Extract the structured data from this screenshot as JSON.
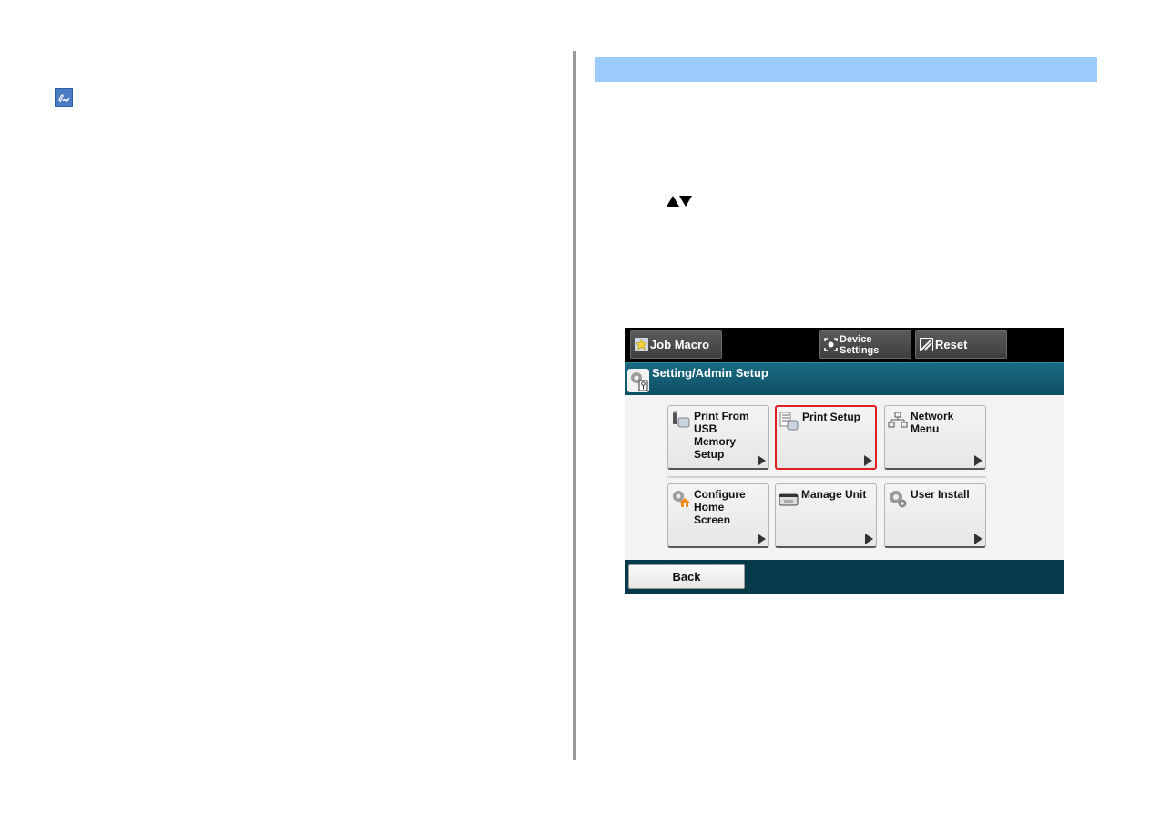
{
  "left_page": {
    "note_icon": "pencil-note-icon"
  },
  "right_page": {
    "section_bar_color": "#9bcbfc",
    "scroll_symbols": {
      "up": "▲",
      "down": "▼"
    }
  },
  "panel": {
    "top_buttons": [
      {
        "label": "Job Macro",
        "icon": "star-icon"
      },
      {
        "label": "Device Settings",
        "label_lines": [
          "Device",
          "Settings"
        ],
        "icon": "device-settings-icon"
      },
      {
        "label": "Reset",
        "icon": "reset-icon"
      }
    ],
    "title": "Setting/Admin Setup",
    "tiles": [
      {
        "label": "Print From\nUSB\nMemory\nSetup",
        "icon": "usb-memory-icon",
        "selected": false
      },
      {
        "label": "Print Setup",
        "icon": "print-setup-icon",
        "selected": true
      },
      {
        "label": "Network\nMenu",
        "icon": "network-icon",
        "selected": false
      },
      {
        "label": "Configure\nHome\nScreen",
        "icon": "configure-home-icon",
        "selected": false
      },
      {
        "label": "Manage Unit",
        "icon": "manage-unit-icon",
        "selected": false
      },
      {
        "label": "User Install",
        "icon": "user-install-icon",
        "selected": false
      }
    ],
    "back_label": "Back",
    "colors": {
      "title_bar": "#0e4f63",
      "bottom_bar": "#043a4a",
      "selected_border": "#e02020"
    }
  }
}
